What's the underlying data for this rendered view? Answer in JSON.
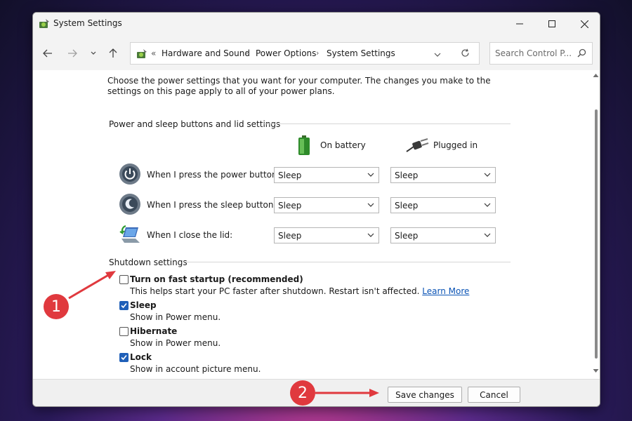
{
  "window": {
    "title": "System Settings",
    "icons": {
      "app": "power-options-icon",
      "minimize": "minimize-icon",
      "maximize": "maximize-icon",
      "close": "close-icon"
    }
  },
  "nav": {
    "back": "back-arrow-icon",
    "forward": "forward-arrow-icon",
    "recent": "chevron-down-icon",
    "up": "up-arrow-icon",
    "breadcrumb_prefix": "«",
    "breadcrumbs": [
      "Hardware and Sound",
      "Power Options",
      "System Settings"
    ],
    "search_placeholder": "Search Control P..."
  },
  "content": {
    "intro": "Choose the power settings that you want for your computer. The changes you make to the settings on this page apply to all of your power plans.",
    "power_section": "Power and sleep buttons and lid settings",
    "columns": {
      "battery": "On battery",
      "plugged": "Plugged in"
    },
    "rows": [
      {
        "label": "When I press the power button:",
        "battery": "Sleep",
        "plugged": "Sleep"
      },
      {
        "label": "When I press the sleep button:",
        "battery": "Sleep",
        "plugged": "Sleep"
      },
      {
        "label": "When I close the lid:",
        "battery": "Sleep",
        "plugged": "Sleep"
      }
    ],
    "shutdown_section": "Shutdown settings",
    "options": [
      {
        "label": "Turn on fast startup (recommended)",
        "desc": "This helps start your PC faster after shutdown. Restart isn't affected.",
        "checked": false
      },
      {
        "label": "Sleep",
        "desc": "Show in Power menu.",
        "checked": true
      },
      {
        "label": "Hibernate",
        "desc": "Show in Power menu.",
        "checked": false
      },
      {
        "label": "Lock",
        "desc": "Show in account picture menu.",
        "checked": true
      }
    ],
    "learn_more": "Learn More"
  },
  "footer": {
    "save": "Save changes",
    "cancel": "Cancel"
  },
  "annotations": {
    "one": "1",
    "two": "2",
    "color": "#e0393e"
  },
  "colors": {
    "accent": "#1f5fb8",
    "link": "#0a53b5"
  }
}
